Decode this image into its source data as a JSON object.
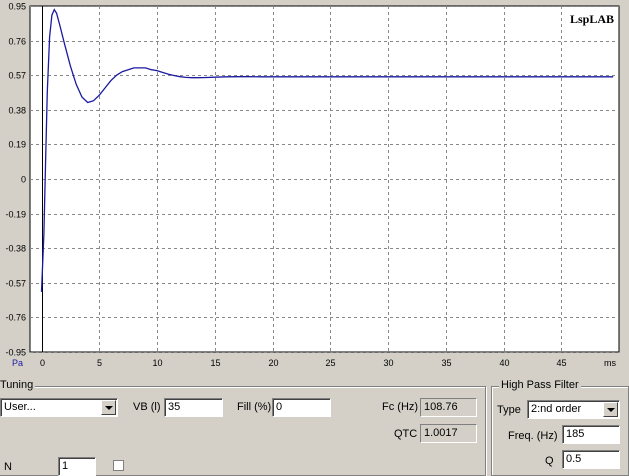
{
  "chart_data": {
    "type": "line",
    "title": "",
    "xlabel": "ms",
    "ylabel": "Pa",
    "xlim": [
      -1,
      50
    ],
    "ylim": [
      -0.95,
      0.95
    ],
    "x_ticks": [
      "0",
      "5",
      "10",
      "15",
      "20",
      "25",
      "30",
      "35",
      "40",
      "45"
    ],
    "x_tick_values": [
      0,
      5,
      10,
      15,
      20,
      25,
      30,
      35,
      40,
      45
    ],
    "y_ticks": [
      "0.95",
      "0.76",
      "0.57",
      "0.38",
      "0.19",
      "0",
      "-0.19",
      "-0.38",
      "-0.57",
      "-0.76",
      "-0.95"
    ],
    "y_tick_values": [
      0.95,
      0.76,
      0.57,
      0.38,
      0.19,
      0,
      -0.19,
      -0.38,
      -0.57,
      -0.76,
      -0.95
    ],
    "grid": true,
    "series": [
      {
        "color": "#1a1aa0",
        "x": [
          0,
          0.2,
          0.35,
          0.5,
          0.7,
          0.9,
          1.1,
          1.3,
          1.6,
          2.0,
          2.5,
          3.0,
          3.5,
          4.0,
          4.5,
          5.0,
          5.5,
          6.0,
          6.5,
          7.0,
          7.5,
          8.0,
          8.5,
          9.0,
          9.5,
          10.0,
          10.5,
          11.0,
          11.5,
          12.0,
          12.5,
          13.0,
          13.5,
          14.0,
          15.0,
          16.0,
          17.0,
          18.0,
          19.0,
          20.0,
          22.0,
          25.0,
          30.0,
          35.0,
          40.0,
          45.0,
          49.5
        ],
        "y": [
          -0.62,
          -0.3,
          0.1,
          0.48,
          0.78,
          0.9,
          0.93,
          0.91,
          0.84,
          0.74,
          0.62,
          0.52,
          0.45,
          0.42,
          0.43,
          0.46,
          0.5,
          0.54,
          0.57,
          0.59,
          0.6,
          0.61,
          0.61,
          0.61,
          0.6,
          0.595,
          0.585,
          0.575,
          0.568,
          0.562,
          0.558,
          0.556,
          0.556,
          0.557,
          0.559,
          0.561,
          0.562,
          0.562,
          0.561,
          0.561,
          0.561,
          0.561,
          0.561,
          0.561,
          0.561,
          0.561,
          0.561
        ]
      }
    ]
  },
  "chart": {
    "logo": "LspLAB",
    "axis_x_unit": "ms",
    "axis_y_unit": "Pa"
  },
  "tuning": {
    "group_title": "Tuning",
    "type_value": "User...",
    "vb_label": "VB (l)",
    "vb_value": "35",
    "fill_label": "Fill (%)",
    "fill_value": "0",
    "fc_label": "Fc (Hz)",
    "fc_value": "108.76",
    "qtc_label": "QTC",
    "qtc_value": "1.0017",
    "bottom_label": "N  ",
    "bottom_value": "1"
  },
  "hpf": {
    "group_title": "High Pass Filter",
    "type_label": "Type",
    "type_value": "2:nd order",
    "freq_label": "Freq. (Hz)",
    "freq_value": "185",
    "q_label": "Q",
    "q_value": "0.5"
  }
}
